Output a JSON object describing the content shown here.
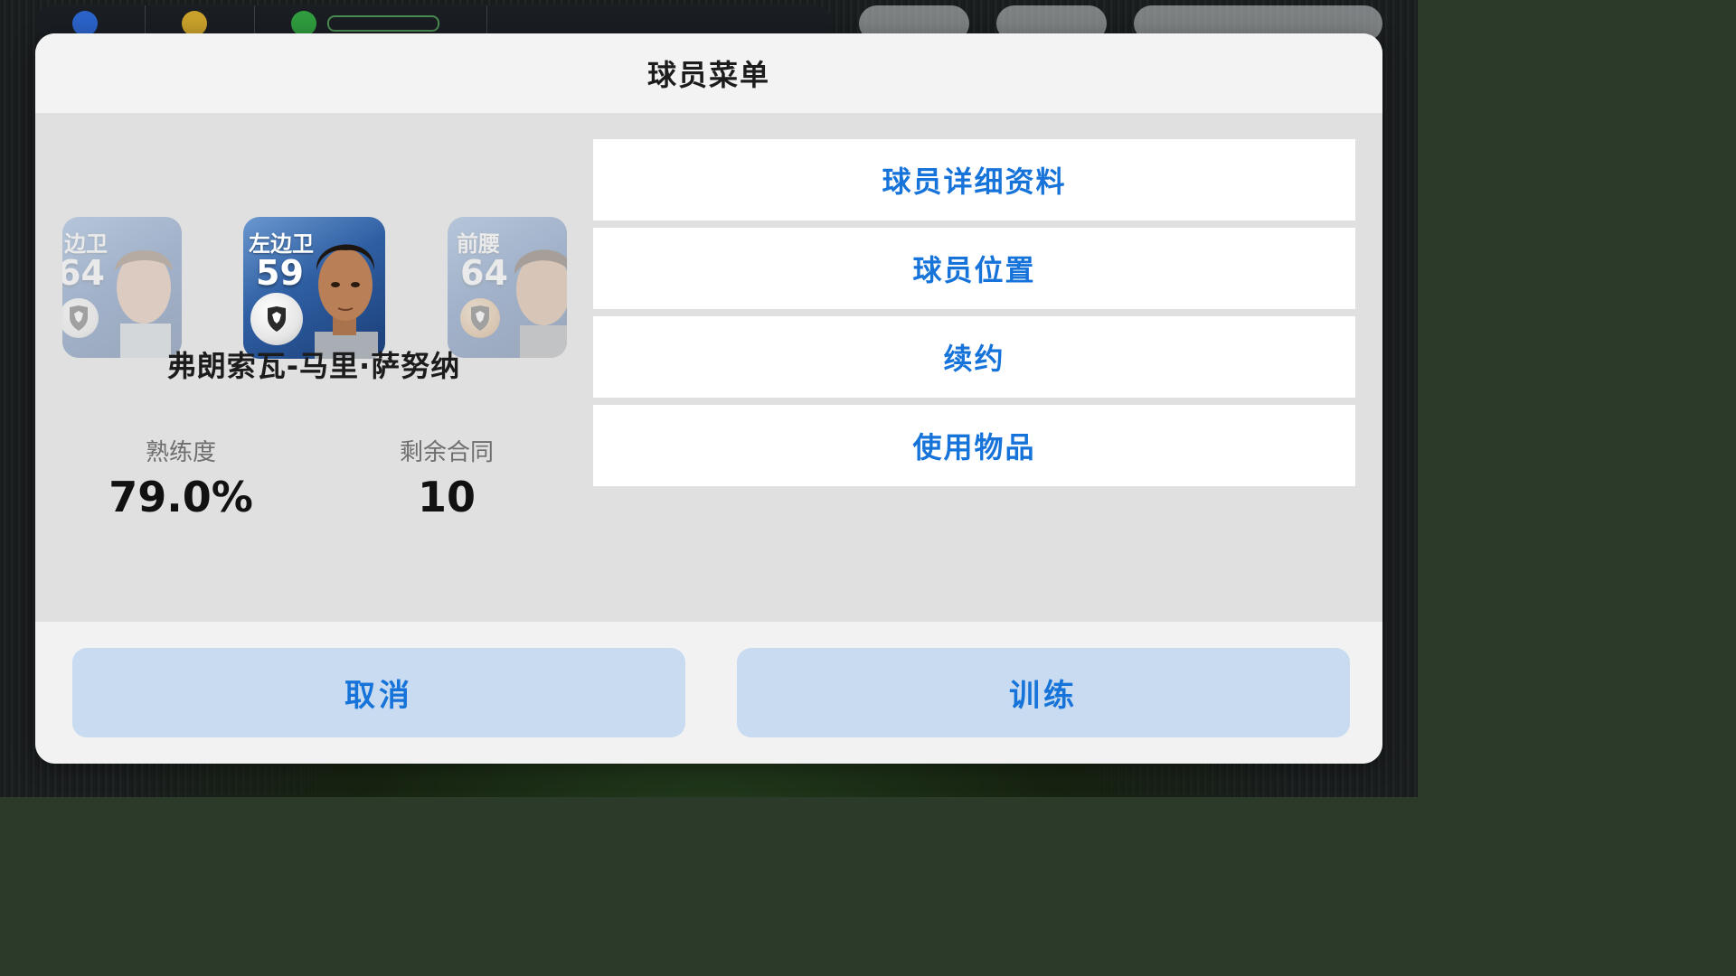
{
  "topbar": {
    "gp_value": "",
    "coins_value": "",
    "stamina_value": ""
  },
  "dialog": {
    "title": "球员菜单"
  },
  "cards": {
    "prev": {
      "position": "边卫",
      "rating": "64"
    },
    "current": {
      "position": "左边卫",
      "rating": "59"
    },
    "next": {
      "position": "前腰",
      "rating": "64"
    }
  },
  "player": {
    "name": "弗朗索瓦-马里·萨努纳"
  },
  "stats": {
    "proficiency_label": "熟练度",
    "proficiency_value": "79.0%",
    "contract_label": "剩余合同",
    "contract_value": "10"
  },
  "menu": {
    "items": [
      {
        "label": "球员详细资料"
      },
      {
        "label": "球员位置"
      },
      {
        "label": "续约"
      },
      {
        "label": "使用物品"
      }
    ]
  },
  "footer": {
    "cancel_label": "取消",
    "train_label": "训练"
  },
  "colors": {
    "accent": "#1673d9",
    "footer_button_bg": "#c8dbf1",
    "body_bg": "#e0e0e0"
  }
}
